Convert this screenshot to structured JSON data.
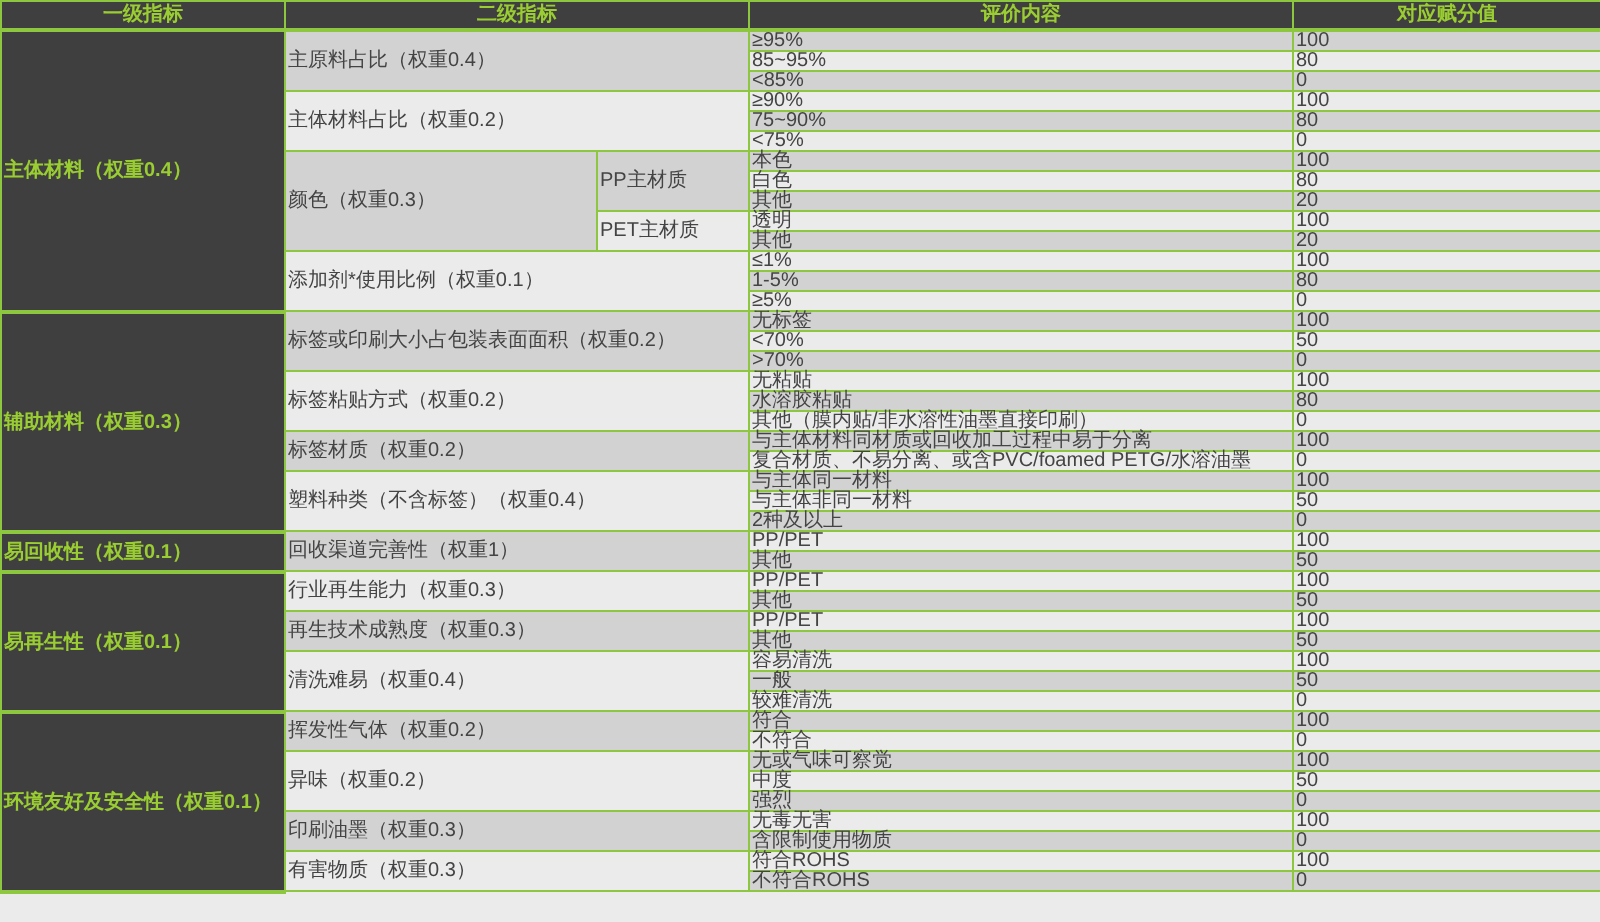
{
  "table": {
    "columns": [
      "一级指标",
      "二级指标",
      "评价内容",
      "对应赋分值"
    ],
    "categories": [
      {
        "label": "主体材料（权重0.4）",
        "items": [
          {
            "label": "主原料占比（权重0.4）",
            "options": [
              {
                "text": "≥95%",
                "score": "100"
              },
              {
                "text": "85~95%",
                "score": "80"
              },
              {
                "text": "<85%",
                "score": "0"
              }
            ]
          },
          {
            "label": "主体材料占比（权重0.2）",
            "options": [
              {
                "text": "≥90%",
                "score": "100"
              },
              {
                "text": "75~90%",
                "score": "80"
              },
              {
                "text": "<75%",
                "score": "0"
              }
            ]
          },
          {
            "label": "颜色（权重0.3）",
            "subitems": [
              {
                "label": "PP主材质",
                "options": [
                  {
                    "text": "本色",
                    "score": "100"
                  },
                  {
                    "text": "白色",
                    "score": "80"
                  },
                  {
                    "text": "其他",
                    "score": "20"
                  }
                ]
              },
              {
                "label": "PET主材质",
                "options": [
                  {
                    "text": "透明",
                    "score": "100"
                  },
                  {
                    "text": "其他",
                    "score": "20"
                  }
                ]
              }
            ]
          },
          {
            "label": "添加剂*使用比例（权重0.1）",
            "options": [
              {
                "text": "≤1%",
                "score": "100"
              },
              {
                "text": "1-5%",
                "score": "80"
              },
              {
                "text": "≥5%",
                "score": "0"
              }
            ]
          }
        ]
      },
      {
        "label": "辅助材料（权重0.3）",
        "items": [
          {
            "label": "标签或印刷大小占包装表面面积（权重0.2）",
            "options": [
              {
                "text": "无标签",
                "score": "100"
              },
              {
                "text": "<70%",
                "score": "50"
              },
              {
                "text": ">70%",
                "score": "0"
              }
            ]
          },
          {
            "label": "标签粘贴方式（权重0.2）",
            "options": [
              {
                "text": "无粘贴",
                "score": "100"
              },
              {
                "text": "水溶胶粘贴",
                "score": "80"
              },
              {
                "text": "其他（膜内贴/非水溶性油墨直接印刷）",
                "score": "0"
              }
            ]
          },
          {
            "label": "标签材质（权重0.2）",
            "options": [
              {
                "text": "与主体材料同材质或回收加工过程中易于分离",
                "score": "100"
              },
              {
                "text": "复合材质、不易分离、或含PVC/foamed PETG/水溶油墨",
                "score": "0"
              }
            ]
          },
          {
            "label": "塑料种类（不含标签）（权重0.4）",
            "options": [
              {
                "text": "与主体同一材料",
                "score": "100"
              },
              {
                "text": "与主体非同一材料",
                "score": "50"
              },
              {
                "text": "2种及以上",
                "score": "0"
              }
            ]
          }
        ]
      },
      {
        "label": "易回收性（权重0.1）",
        "items": [
          {
            "label": "回收渠道完善性（权重1）",
            "options": [
              {
                "text": "PP/PET",
                "score": "100"
              },
              {
                "text": "其他",
                "score": "50"
              }
            ]
          }
        ]
      },
      {
        "label": "易再生性（权重0.1）",
        "items": [
          {
            "label": "行业再生能力（权重0.3）",
            "options": [
              {
                "text": "PP/PET",
                "score": "100"
              },
              {
                "text": "其他",
                "score": "50"
              }
            ]
          },
          {
            "label": "再生技术成熟度（权重0.3）",
            "options": [
              {
                "text": "PP/PET",
                "score": "100"
              },
              {
                "text": "其他",
                "score": "50"
              }
            ]
          },
          {
            "label": "清洗难易（权重0.4）",
            "options": [
              {
                "text": "容易清洗",
                "score": "100"
              },
              {
                "text": "一般",
                "score": "50"
              },
              {
                "text": "较难清洗",
                "score": "0"
              }
            ]
          }
        ]
      },
      {
        "label": "环境友好及安全性（权重0.1）",
        "items": [
          {
            "label": "挥发性气体（权重0.2）",
            "options": [
              {
                "text": "符合",
                "score": "100"
              },
              {
                "text": "不符合",
                "score": "0"
              }
            ]
          },
          {
            "label": "异味（权重0.2）",
            "options": [
              {
                "text": "无或气味可察觉",
                "score": "100"
              },
              {
                "text": "中度",
                "score": "50"
              },
              {
                "text": "强烈",
                "score": "0"
              }
            ]
          },
          {
            "label": "印刷油墨（权重0.3）",
            "options": [
              {
                "text": "无毒无害",
                "score": "100"
              },
              {
                "text": "含限制使用物质",
                "score": "0"
              }
            ]
          },
          {
            "label": "有害物质（权重0.3）",
            "options": [
              {
                "text": "符合ROHS",
                "score": "100"
              },
              {
                "text": "不符合ROHS",
                "score": "0"
              }
            ]
          }
        ]
      }
    ]
  }
}
